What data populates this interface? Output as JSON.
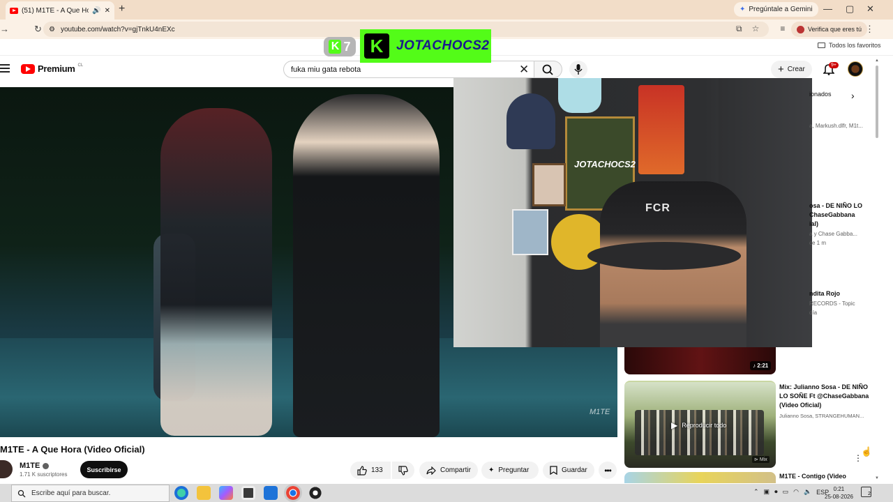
{
  "browser": {
    "tab_title": "(51) M1TE - A Que Hora (Vi",
    "new_tab": "+",
    "gemini_label": "Pregúntale a Gemini",
    "url": "youtube.com/watch?v=gjTnkU4nEXc",
    "profile_label": "Verifica que eres tú",
    "bookmarks_label": "Todos los favoritos",
    "window_controls": [
      "—",
      "▢",
      "✕"
    ]
  },
  "overlay": {
    "k7_text": "7",
    "kick_logo": "K",
    "kick_name": "JOTACHOCS2"
  },
  "youtube": {
    "logo_word": "Premium",
    "country": "CL",
    "search_query": "fuka miu gata rebota",
    "create_label": "Crear",
    "notif_badge": "9+"
  },
  "video": {
    "watermark": "M1TE",
    "title": "M1TE - A Que Hora (Video Oficial)",
    "channel": "M1TE",
    "subscribers": "1.71 K suscriptores",
    "subscribe_label": "Suscribirse",
    "likes": "133",
    "share_label": "Compartir",
    "ask_label": "Preguntar",
    "save_label": "Guardar"
  },
  "webcam": {
    "poster_text": "JOTACHOCS2",
    "cap_text": "FCR"
  },
  "sidebar": {
    "chip_selected": "ionados",
    "chip_next": "›",
    "fragments": [
      {
        "text": "a, Markush.dlfr, M1t...",
        "title": false
      },
      {
        "text": "osa - DE NIÑO LO",
        "title": true
      },
      {
        "text": "ChaseGabbana",
        "title": true
      },
      {
        "text": "ial)",
        "title": true
      },
      {
        "text": "a  y Chase Gabba...",
        "title": false
      },
      {
        "text": "ce 1 m",
        "title": false
      },
      {
        "text": "ndita Rojo",
        "title": true
      },
      {
        "text": "RECORDS - Topic",
        "title": false
      },
      {
        "text": "día",
        "title": false
      }
    ],
    "rec1_duration": "2:21",
    "rec2": {
      "play_all": "Reproducir todo",
      "title": "Mix: Julianno Sosa - DE NIÑO LO SOÑE Ft @ChaseGabbana (Video Oficial)",
      "channel": "Julianno Sosa, STRANGEHUMAN...",
      "badge": "Mix"
    },
    "rec3_title": "M1TE - Contigo (Video"
  },
  "taskbar": {
    "search_placeholder": "Escribe aquí para buscar.",
    "language": "ESP",
    "time": "0:21",
    "date": "25-08-2026",
    "notif_count": "2"
  }
}
